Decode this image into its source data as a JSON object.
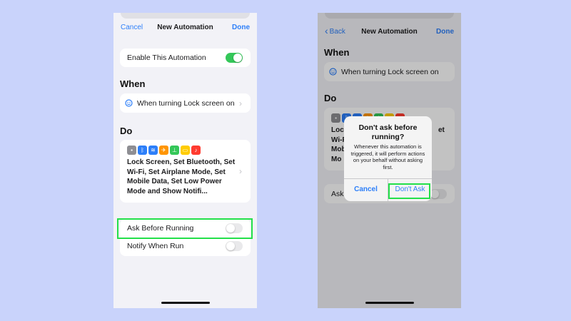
{
  "colors": {
    "background": "#c9d3fb",
    "accent_blue": "#2d7ff9",
    "toggle_on": "#34c759",
    "highlight_green": "#23e04a"
  },
  "left_screen": {
    "nav": {
      "cancel": "Cancel",
      "title": "New Automation",
      "done": "Done"
    },
    "enable": {
      "label": "Enable This Automation",
      "toggle_on": true
    },
    "when_header": "When",
    "trigger": {
      "icon": "lock-screen-icon",
      "label": "When turning Lock screen on"
    },
    "do_header": "Do",
    "actions": {
      "icons": [
        {
          "name": "lock-icon",
          "color": "#8e8e93",
          "glyph": "🔒"
        },
        {
          "name": "bluetooth-icon",
          "color": "#2d7ff9",
          "glyph": "ᛒ"
        },
        {
          "name": "wifi-icon",
          "color": "#2d7ff9",
          "glyph": "≋"
        },
        {
          "name": "airplane-icon",
          "color": "#ff9500",
          "glyph": "✈"
        },
        {
          "name": "mobile-data-icon",
          "color": "#34c759",
          "glyph": "⟟"
        },
        {
          "name": "low-power-icon",
          "color": "#ffcc00",
          "glyph": "▭"
        },
        {
          "name": "notification-icon",
          "color": "#ff3b30",
          "glyph": "🔔"
        }
      ],
      "summary": "Lock Screen, Set Bluetooth, Set Wi-Fi, Set Airplane Mode, Set Mobile Data, Set Low Power Mode and Show Notifi..."
    },
    "ask": {
      "label": "Ask Before Running",
      "toggle_on": false
    },
    "notify": {
      "label": "Notify When Run",
      "toggle_on": false
    }
  },
  "right_screen": {
    "nav": {
      "back": "Back",
      "title": "New Automation",
      "done": "Done"
    },
    "when_header": "When",
    "trigger_label": "When turning Lock screen on",
    "do_header": "Do",
    "actions_partial": [
      "Lock",
      "Wi-Fi",
      "Mob",
      "Mo"
    ],
    "actions_partial_right": "et",
    "ask_partial": "Ask",
    "alert": {
      "title": "Don't ask before running?",
      "message": "Whenever this automation is triggered, it will perform actions on your behalf without asking first.",
      "cancel": "Cancel",
      "confirm": "Don't Ask"
    }
  }
}
